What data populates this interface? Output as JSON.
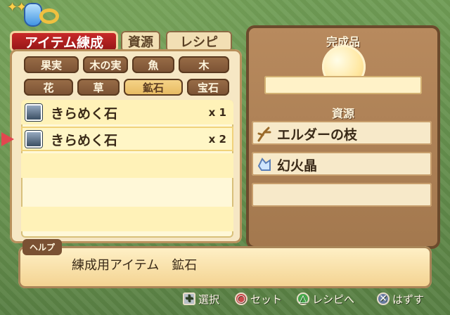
{
  "tabs": {
    "main": "アイテム練成",
    "resources": "資源",
    "recipes": "レシピ"
  },
  "categories": [
    {
      "label": "果実",
      "selected": false
    },
    {
      "label": "木の実",
      "selected": false
    },
    {
      "label": "魚",
      "selected": false
    },
    {
      "label": "木",
      "selected": false
    },
    {
      "label": "花",
      "selected": false
    },
    {
      "label": "草",
      "selected": false
    },
    {
      "label": "鉱石",
      "selected": true
    },
    {
      "label": "宝石",
      "selected": false
    }
  ],
  "items": [
    {
      "name": "きらめく石",
      "qty": "x 1",
      "selected": false
    },
    {
      "name": "きらめく石",
      "qty": "x 2",
      "selected": true
    }
  ],
  "right_panel": {
    "complete_label": "完成品",
    "resource_label": "資源",
    "resources": [
      {
        "name": "エルダーの枝",
        "icon": "branch-icon"
      },
      {
        "name": "幻火晶",
        "icon": "crystal-icon"
      }
    ]
  },
  "help": {
    "tag": "ヘルプ",
    "text": "練成用アイテム　鉱石"
  },
  "buttons": [
    {
      "glyph": "✚",
      "label": "選択",
      "icon": "dpad-icon"
    },
    {
      "glyph": "○",
      "label": "セット",
      "icon": "circle-button-icon"
    },
    {
      "glyph": "△",
      "label": "レシピへ",
      "icon": "triangle-button-icon"
    },
    {
      "glyph": "✕",
      "label": "はずす",
      "icon": "cross-button-icon"
    }
  ],
  "colors": {
    "main_tab": "#8f1515",
    "selected_category": "#e6b960",
    "background": "#5f8f4a"
  }
}
